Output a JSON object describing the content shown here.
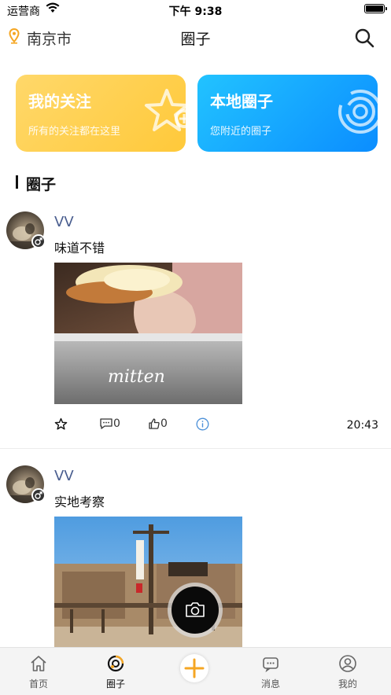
{
  "status_bar": {
    "carrier": "运营商",
    "time": "下午 9:38"
  },
  "header": {
    "city": "南京市",
    "title": "圈子"
  },
  "cards": [
    {
      "title": "我的关注",
      "subtitle": "所有的关注都在这里",
      "color": "#ffcc44"
    },
    {
      "title": "本地圈子",
      "subtitle": "您附近的圈子",
      "color": "#139dff"
    }
  ],
  "section": {
    "title": "圈子"
  },
  "posts": [
    {
      "username": "VV",
      "content": "味道不错",
      "comments": "0",
      "likes": "0",
      "time": "20:43"
    },
    {
      "username": "VV",
      "content": "实地考察"
    }
  ],
  "tabs": [
    {
      "label": "首页",
      "icon": "home-icon"
    },
    {
      "label": "圈子",
      "icon": "circle-icon"
    },
    {
      "label": "",
      "icon": "add-icon"
    },
    {
      "label": "消息",
      "icon": "message-icon"
    },
    {
      "label": "我的",
      "icon": "profile-icon"
    }
  ],
  "colors": {
    "accent": "#f5a623",
    "username": "#4a5e8f",
    "info": "#4a8fd8"
  }
}
